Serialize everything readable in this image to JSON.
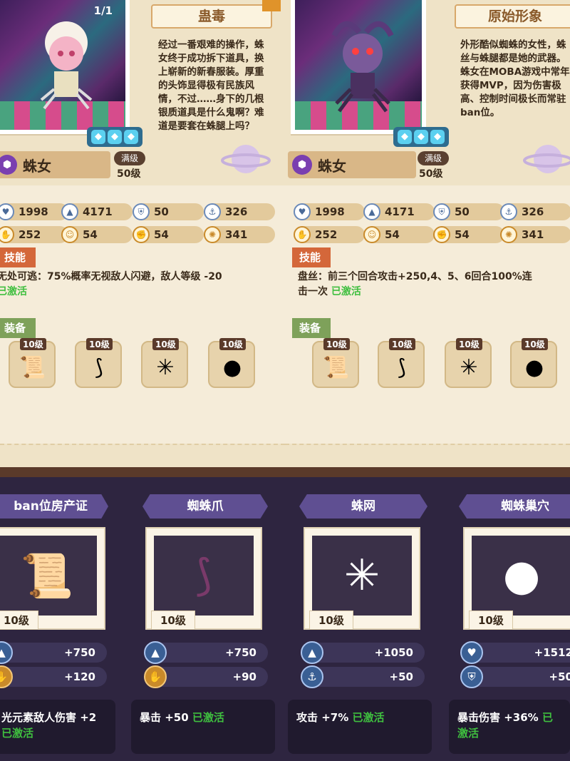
{
  "left_panel": {
    "page_count": "1/1",
    "title": "蛊毒",
    "description": "经过一番艰难的操作，蛛女终于成功拆下道具，换上崭新的新春服装。厚重的头饰显得极有民族风情，不过……身下的几根银质道具是什么鬼啊？难道是要套在蛛腿上吗？",
    "name": "蛛女",
    "max_badge": "满级",
    "level": "50级",
    "stats": [
      "1998",
      "4171",
      "50",
      "326",
      "252",
      "54",
      "54",
      "341"
    ],
    "skill_tag": "技能",
    "skill_text": "无处可逃：75%概率无视敌人闪避，敌人等级 -20",
    "skill_active": "已激活",
    "equip_tag": "装备",
    "equip_levels": [
      "10级",
      "10级",
      "10级",
      "10级"
    ]
  },
  "right_panel": {
    "title": "原始形象",
    "description": "外形酷似蜘蛛的女性，蛛丝与蛛腿都是她的武器。蛛女在MOBA游戏中常年获得MVP，因为伤害极高、控制时间极长而常驻ban位。",
    "name": "蛛女",
    "max_badge": "满级",
    "level": "50级",
    "stats": [
      "1998",
      "4171",
      "50",
      "326",
      "252",
      "54",
      "54",
      "341"
    ],
    "skill_tag": "技能",
    "skill_text_1": "盘丝：前三个回合攻击+250,4、5、6回合100%连",
    "skill_text_2": "击一次",
    "skill_active": "已激活",
    "equip_tag": "装备",
    "equip_levels": [
      "10级",
      "10级",
      "10级",
      "10级"
    ]
  },
  "equipment": [
    {
      "name": "ban位房产证",
      "level": "10级",
      "bonus1": "+750",
      "bonus2": "+120",
      "effect": "光元素敌人伤害 +2",
      "active": "已激活"
    },
    {
      "name": "蜘蛛爪",
      "level": "10级",
      "bonus1": "+750",
      "bonus2": "+90",
      "effect": "暴击 +50",
      "active": "已激活"
    },
    {
      "name": "蛛网",
      "level": "10级",
      "bonus1": "+1050",
      "bonus2": "+50",
      "effect": "攻击 +7%",
      "active": "已激活"
    },
    {
      "name": "蜘蛛巢穴",
      "level": "10级",
      "bonus1": "+1512",
      "bonus2": "+50",
      "effect": "暴击伤害 +36%",
      "active": "已激活"
    }
  ]
}
